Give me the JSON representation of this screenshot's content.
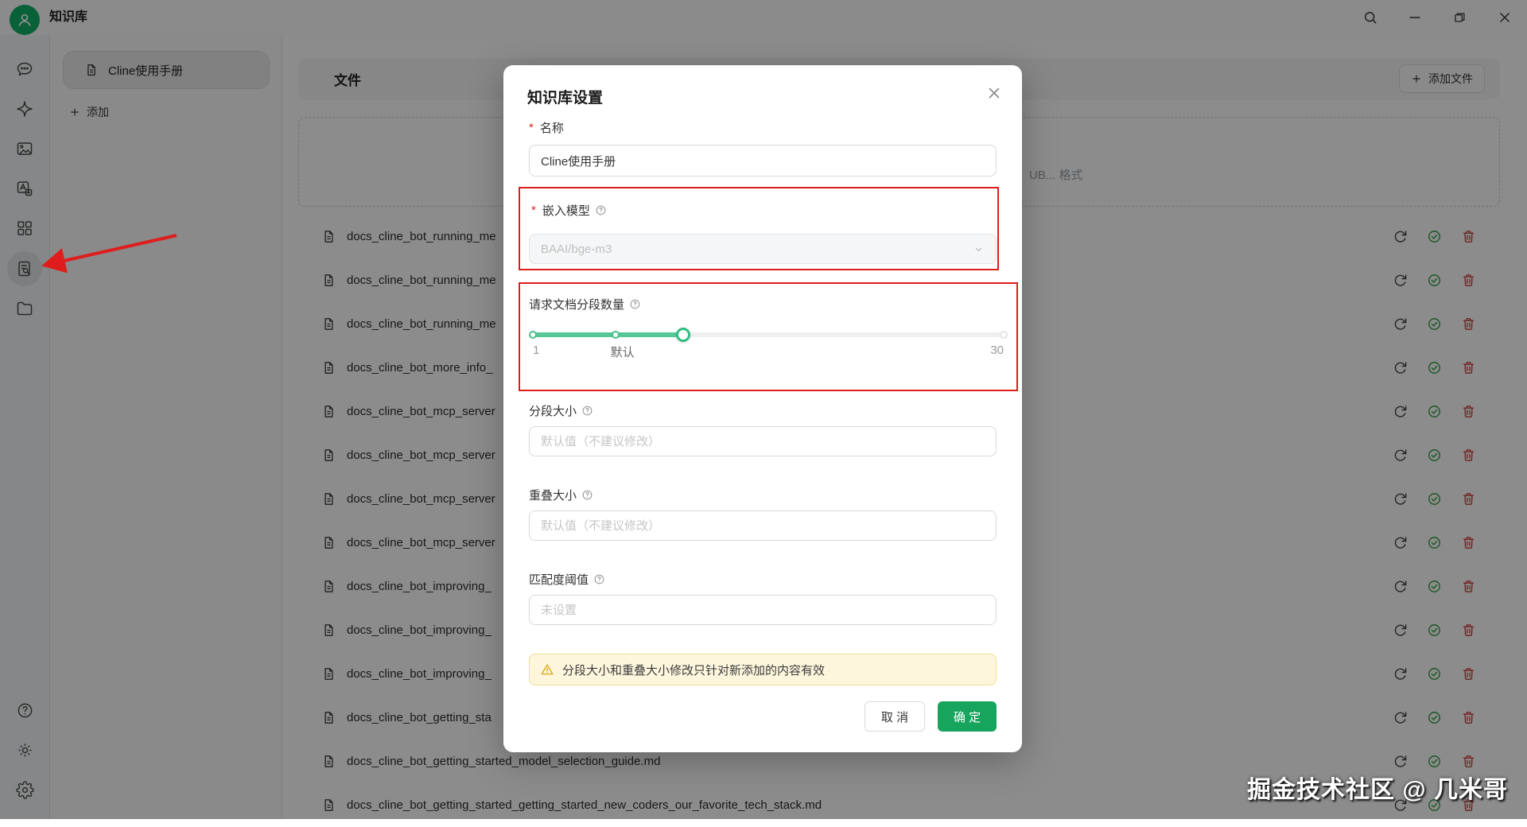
{
  "titlebar": {
    "app_title": "知识库",
    "icons": [
      "search-icon",
      "minimize-icon",
      "restore-icon",
      "close-icon"
    ]
  },
  "sidebar": {
    "icons": [
      "chat-icon",
      "sparkle-icon",
      "images-icon",
      "translate-icon",
      "apps-grid-icon",
      "knowledge-base-icon",
      "folder-icon"
    ],
    "bottom_icons": [
      "help-icon",
      "theme-icon",
      "settings-icon"
    ],
    "active": "knowledge-base-icon"
  },
  "left_panel": {
    "selected_item": "Cline使用手册",
    "add_label": "添加"
  },
  "files": {
    "header": "文件",
    "add_file_label": "添加文件",
    "dropzone_hint": "UB... 格式",
    "rows": [
      "docs_cline_bot_running_me",
      "docs_cline_bot_running_me",
      "docs_cline_bot_running_me",
      "docs_cline_bot_more_info_",
      "docs_cline_bot_mcp_server",
      "docs_cline_bot_mcp_server",
      "docs_cline_bot_mcp_server",
      "docs_cline_bot_mcp_server",
      "docs_cline_bot_improving_",
      "docs_cline_bot_improving_",
      "docs_cline_bot_improving_",
      "docs_cline_bot_getting_sta",
      "docs_cline_bot_getting_started_model_selection_guide.md",
      "docs_cline_bot_getting_started_getting_started_new_coders_our_favorite_tech_stack.md"
    ],
    "row_action_icons": [
      "refresh-icon",
      "check-circle-icon",
      "trash-icon"
    ]
  },
  "modal": {
    "title": "知识库设置",
    "required_mark": "*",
    "fields": {
      "name": {
        "label": "名称",
        "value": "Cline使用手册"
      },
      "embedding": {
        "label": "嵌入模型",
        "value": "BAAI/bge-m3"
      },
      "segments": {
        "label": "请求文档分段数量"
      },
      "chunk_size": {
        "label": "分段大小",
        "placeholder": "默认值（不建议修改）"
      },
      "overlap_size": {
        "label": "重叠大小",
        "placeholder": "默认值（不建议修改）"
      },
      "threshold": {
        "label": "匹配度阈值",
        "placeholder": "未设置"
      }
    },
    "slider": {
      "min_label": "1",
      "default_label": "默认",
      "max_label": "30",
      "current_percent": 32,
      "default_percent": 17.5
    },
    "warning": "分段大小和重叠大小修改只针对新添加的内容有效",
    "cancel_label": "取 消",
    "ok_label": "确 定"
  },
  "watermark": {
    "text": "掘金技术社区 @ 几米哥"
  },
  "colors": {
    "primary_green": "#17a45c",
    "slider_green": "#56c795",
    "check_green": "#35a147",
    "trash_red": "#d43a3a",
    "annotation_red": "#e01d1d",
    "warning_bg": "#fdf6dd",
    "warning_border": "#f3dd8f"
  }
}
